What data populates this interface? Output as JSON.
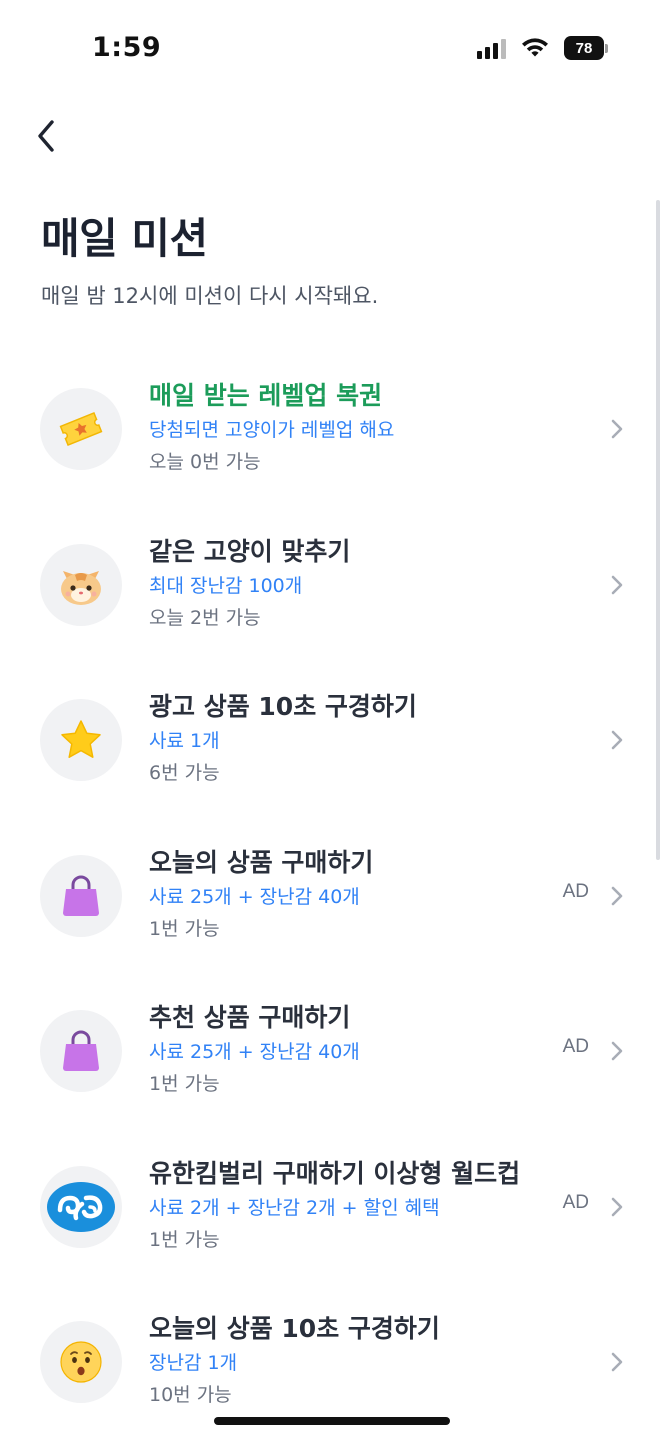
{
  "status_bar": {
    "time": "1:59",
    "battery": "78"
  },
  "header": {
    "back_icon": "chevron-left-icon",
    "title": "매일 미션",
    "subtitle": "매일 밤 12시에 미션이 다시 시작돼요."
  },
  "missions": [
    {
      "icon": "ticket-icon",
      "title": "매일 받는 레벨업 복권",
      "reward": "당첨되면 고양이가 레벨업 해요",
      "limit": "오늘 0번 가능",
      "ad": ""
    },
    {
      "icon": "cat-face-icon",
      "title": "같은 고양이 맞추기",
      "reward": "최대 장난감 100개",
      "limit": "오늘 2번 가능",
      "ad": ""
    },
    {
      "icon": "star-icon",
      "title": "광고 상품 10초 구경하기",
      "reward": "사료 1개",
      "limit": "6번 가능",
      "ad": ""
    },
    {
      "icon": "shopping-bag-icon",
      "title": "오늘의 상품 구매하기",
      "reward": "사료 25개 + 장난감 40개",
      "limit": "1번 가능",
      "ad": "AD"
    },
    {
      "icon": "shopping-bag-icon",
      "title": "추천 상품 구매하기",
      "reward": "사료 25개 + 장난감 40개",
      "limit": "1번 가능",
      "ad": "AD"
    },
    {
      "icon": "yuhan-kimberly-logo-icon",
      "title": "유한킴벌리 구매하기 이상형 월드컵",
      "reward": "사료 2개 + 장난감 2개 + 할인 혜택",
      "limit": "1번 가능",
      "ad": "AD"
    },
    {
      "icon": "surprised-face-icon",
      "title": "오늘의 상품 10초 구경하기",
      "reward": "장난감 1개",
      "limit": "10번 가능",
      "ad": ""
    }
  ],
  "colors": {
    "title_highlight": "#1c9c5a",
    "reward_blue": "#3182f6",
    "secondary_gray": "#6b7280",
    "icon_background": "#f1f2f4"
  }
}
